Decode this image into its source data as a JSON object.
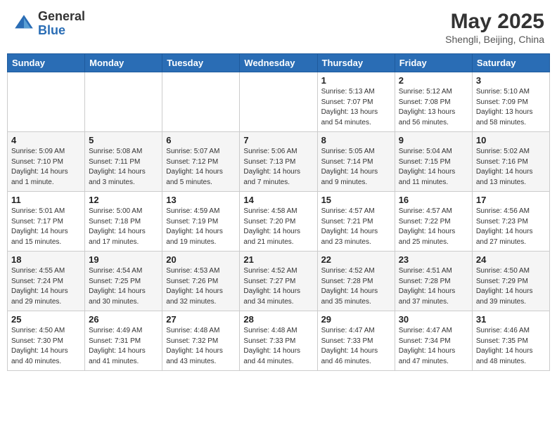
{
  "header": {
    "logo_general": "General",
    "logo_blue": "Blue",
    "month_year": "May 2025",
    "location": "Shengli, Beijing, China"
  },
  "days_of_week": [
    "Sunday",
    "Monday",
    "Tuesday",
    "Wednesday",
    "Thursday",
    "Friday",
    "Saturday"
  ],
  "weeks": [
    [
      {
        "day": "",
        "info": ""
      },
      {
        "day": "",
        "info": ""
      },
      {
        "day": "",
        "info": ""
      },
      {
        "day": "",
        "info": ""
      },
      {
        "day": "1",
        "info": "Sunrise: 5:13 AM\nSunset: 7:07 PM\nDaylight: 13 hours\nand 54 minutes."
      },
      {
        "day": "2",
        "info": "Sunrise: 5:12 AM\nSunset: 7:08 PM\nDaylight: 13 hours\nand 56 minutes."
      },
      {
        "day": "3",
        "info": "Sunrise: 5:10 AM\nSunset: 7:09 PM\nDaylight: 13 hours\nand 58 minutes."
      }
    ],
    [
      {
        "day": "4",
        "info": "Sunrise: 5:09 AM\nSunset: 7:10 PM\nDaylight: 14 hours\nand 1 minute."
      },
      {
        "day": "5",
        "info": "Sunrise: 5:08 AM\nSunset: 7:11 PM\nDaylight: 14 hours\nand 3 minutes."
      },
      {
        "day": "6",
        "info": "Sunrise: 5:07 AM\nSunset: 7:12 PM\nDaylight: 14 hours\nand 5 minutes."
      },
      {
        "day": "7",
        "info": "Sunrise: 5:06 AM\nSunset: 7:13 PM\nDaylight: 14 hours\nand 7 minutes."
      },
      {
        "day": "8",
        "info": "Sunrise: 5:05 AM\nSunset: 7:14 PM\nDaylight: 14 hours\nand 9 minutes."
      },
      {
        "day": "9",
        "info": "Sunrise: 5:04 AM\nSunset: 7:15 PM\nDaylight: 14 hours\nand 11 minutes."
      },
      {
        "day": "10",
        "info": "Sunrise: 5:02 AM\nSunset: 7:16 PM\nDaylight: 14 hours\nand 13 minutes."
      }
    ],
    [
      {
        "day": "11",
        "info": "Sunrise: 5:01 AM\nSunset: 7:17 PM\nDaylight: 14 hours\nand 15 minutes."
      },
      {
        "day": "12",
        "info": "Sunrise: 5:00 AM\nSunset: 7:18 PM\nDaylight: 14 hours\nand 17 minutes."
      },
      {
        "day": "13",
        "info": "Sunrise: 4:59 AM\nSunset: 7:19 PM\nDaylight: 14 hours\nand 19 minutes."
      },
      {
        "day": "14",
        "info": "Sunrise: 4:58 AM\nSunset: 7:20 PM\nDaylight: 14 hours\nand 21 minutes."
      },
      {
        "day": "15",
        "info": "Sunrise: 4:57 AM\nSunset: 7:21 PM\nDaylight: 14 hours\nand 23 minutes."
      },
      {
        "day": "16",
        "info": "Sunrise: 4:57 AM\nSunset: 7:22 PM\nDaylight: 14 hours\nand 25 minutes."
      },
      {
        "day": "17",
        "info": "Sunrise: 4:56 AM\nSunset: 7:23 PM\nDaylight: 14 hours\nand 27 minutes."
      }
    ],
    [
      {
        "day": "18",
        "info": "Sunrise: 4:55 AM\nSunset: 7:24 PM\nDaylight: 14 hours\nand 29 minutes."
      },
      {
        "day": "19",
        "info": "Sunrise: 4:54 AM\nSunset: 7:25 PM\nDaylight: 14 hours\nand 30 minutes."
      },
      {
        "day": "20",
        "info": "Sunrise: 4:53 AM\nSunset: 7:26 PM\nDaylight: 14 hours\nand 32 minutes."
      },
      {
        "day": "21",
        "info": "Sunrise: 4:52 AM\nSunset: 7:27 PM\nDaylight: 14 hours\nand 34 minutes."
      },
      {
        "day": "22",
        "info": "Sunrise: 4:52 AM\nSunset: 7:28 PM\nDaylight: 14 hours\nand 35 minutes."
      },
      {
        "day": "23",
        "info": "Sunrise: 4:51 AM\nSunset: 7:28 PM\nDaylight: 14 hours\nand 37 minutes."
      },
      {
        "day": "24",
        "info": "Sunrise: 4:50 AM\nSunset: 7:29 PM\nDaylight: 14 hours\nand 39 minutes."
      }
    ],
    [
      {
        "day": "25",
        "info": "Sunrise: 4:50 AM\nSunset: 7:30 PM\nDaylight: 14 hours\nand 40 minutes."
      },
      {
        "day": "26",
        "info": "Sunrise: 4:49 AM\nSunset: 7:31 PM\nDaylight: 14 hours\nand 41 minutes."
      },
      {
        "day": "27",
        "info": "Sunrise: 4:48 AM\nSunset: 7:32 PM\nDaylight: 14 hours\nand 43 minutes."
      },
      {
        "day": "28",
        "info": "Sunrise: 4:48 AM\nSunset: 7:33 PM\nDaylight: 14 hours\nand 44 minutes."
      },
      {
        "day": "29",
        "info": "Sunrise: 4:47 AM\nSunset: 7:33 PM\nDaylight: 14 hours\nand 46 minutes."
      },
      {
        "day": "30",
        "info": "Sunrise: 4:47 AM\nSunset: 7:34 PM\nDaylight: 14 hours\nand 47 minutes."
      },
      {
        "day": "31",
        "info": "Sunrise: 4:46 AM\nSunset: 7:35 PM\nDaylight: 14 hours\nand 48 minutes."
      }
    ]
  ]
}
